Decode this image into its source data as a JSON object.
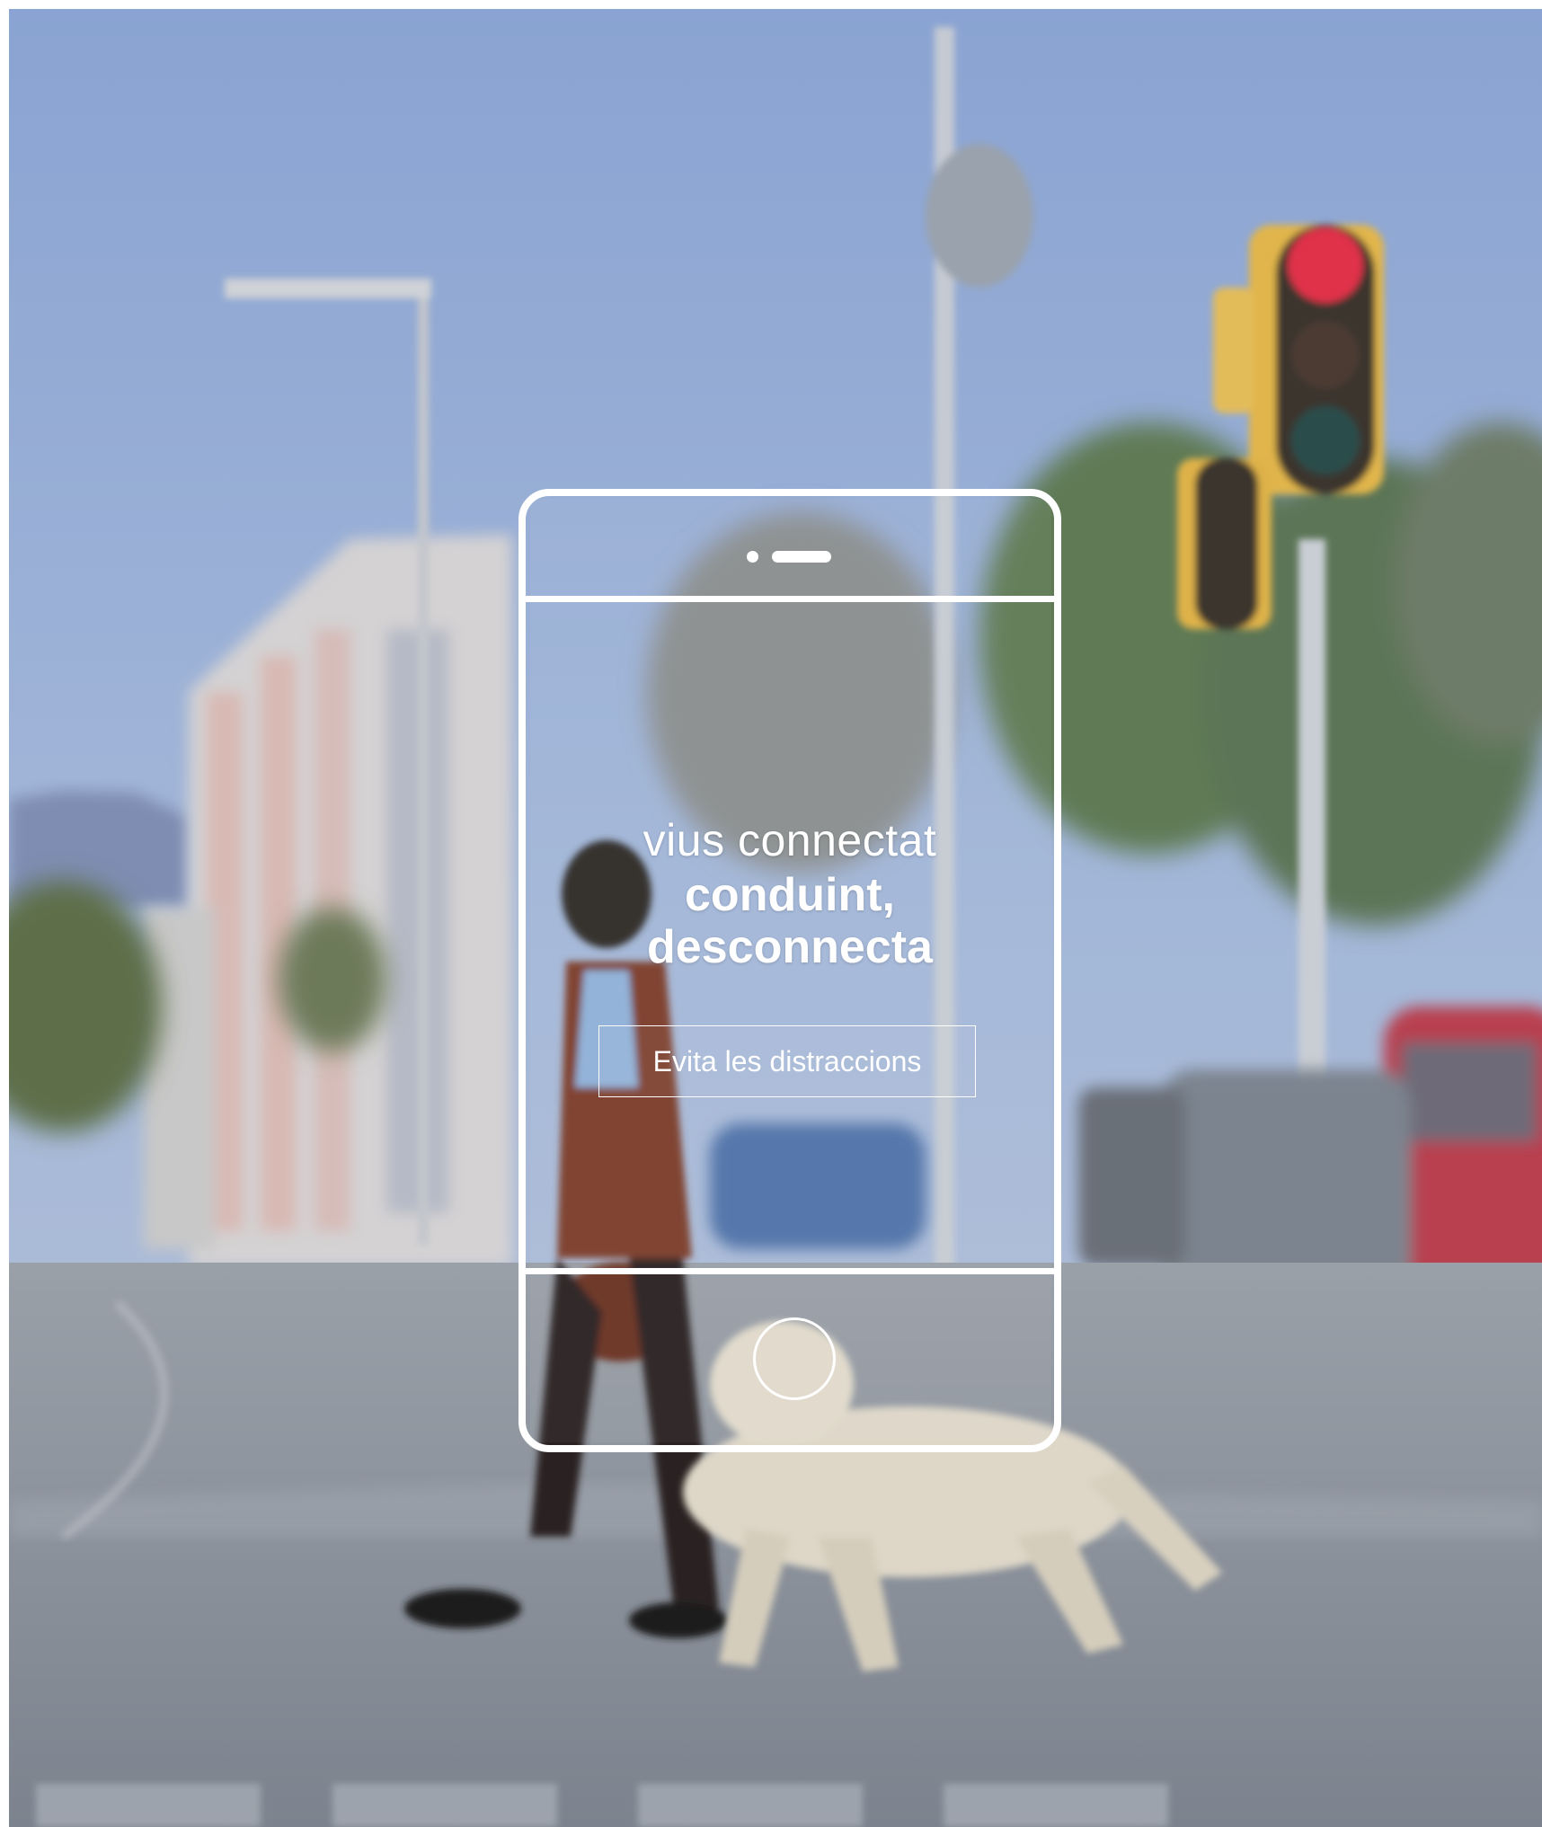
{
  "poster": {
    "headline_line1": "vius connectat",
    "headline_line2": "conduint,",
    "headline_line3": "desconnecta",
    "cta_label": "Evita les distraccions"
  },
  "colors": {
    "sky": "#8fa7d1",
    "frame_outline": "#ffffff",
    "traffic_light_red": "#e0304a",
    "traffic_light_housing": "#e6b84a",
    "street": "#8a909a"
  },
  "icons": [
    "smartphone-outline-icon",
    "camera-dot-icon",
    "speaker-slot-icon",
    "home-button-icon"
  ]
}
